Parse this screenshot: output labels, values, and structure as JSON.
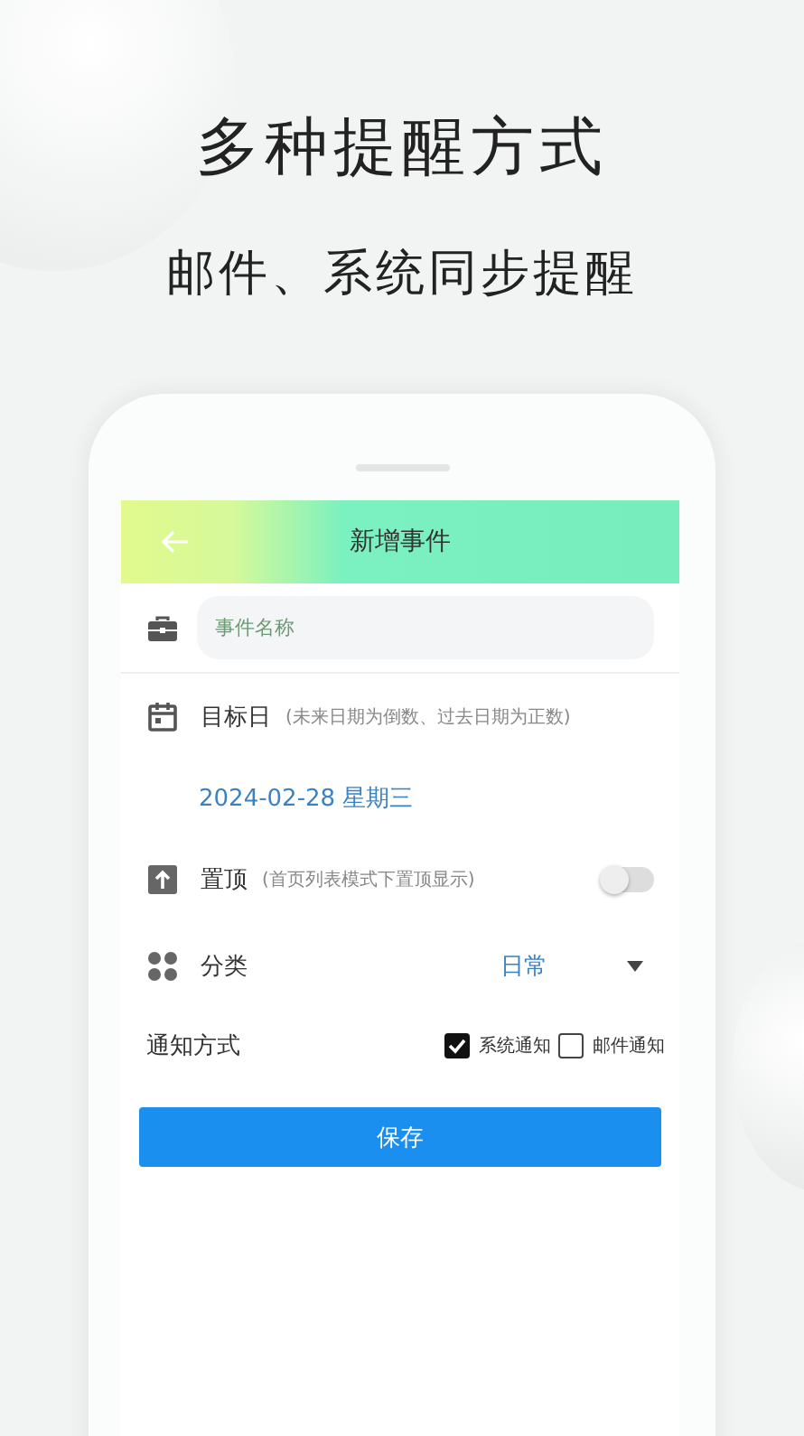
{
  "headline": "多种提醒方式",
  "subheadline": "邮件、系统同步提醒",
  "app": {
    "header": {
      "title": "新增事件"
    },
    "name_field": {
      "placeholder": "事件名称"
    },
    "target_date": {
      "label": "目标日",
      "hint": "(未来日期为倒数、过去日期为正数)",
      "value": "2024-02-28 星期三"
    },
    "pin_top": {
      "label": "置顶",
      "hint": "(首页列表模式下置顶显示)",
      "on": false
    },
    "category": {
      "label": "分类",
      "value": "日常"
    },
    "notify": {
      "label": "通知方式",
      "options": [
        {
          "label": "系统通知",
          "checked": true
        },
        {
          "label": "邮件通知",
          "checked": false
        }
      ]
    },
    "save_button": "保存"
  }
}
